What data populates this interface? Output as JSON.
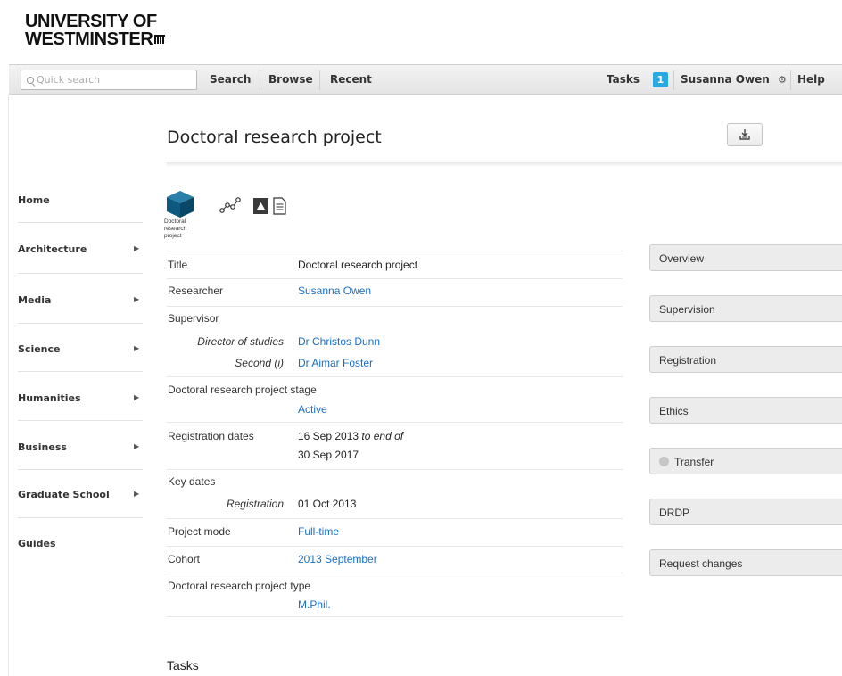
{
  "brand": {
    "line1": "UNIVERSITY OF",
    "line2": "WESTMINSTER"
  },
  "topbar": {
    "search_placeholder": "Quick search",
    "links": [
      "Search",
      "Browse",
      "Recent"
    ],
    "tasks_label": "Tasks",
    "tasks_count": "1",
    "user_name": "Susanna Owen",
    "help_label": "Help"
  },
  "page": {
    "title": "Doctoral research project"
  },
  "sidebar": {
    "items": [
      {
        "label": "Home",
        "has_arrow": false
      },
      {
        "label": "Architecture",
        "has_arrow": true
      },
      {
        "label": "Media",
        "has_arrow": true
      },
      {
        "label": "Science",
        "has_arrow": true
      },
      {
        "label": "Humanities",
        "has_arrow": true
      },
      {
        "label": "Business",
        "has_arrow": true
      },
      {
        "label": "Graduate School",
        "has_arrow": true
      },
      {
        "label": "Guides",
        "has_arrow": false
      }
    ],
    "arrow_glyph": "▶"
  },
  "object": {
    "icon_label_lines": [
      "Doctoral",
      "research",
      "project"
    ],
    "tool_icons": [
      "relationships-icon",
      "up-triangle-icon",
      "document-icon"
    ]
  },
  "details": {
    "title_label": "Title",
    "title_value": "Doctoral research project",
    "researcher_label": "Researcher",
    "researcher_value": "Susanna Owen",
    "supervisor_label": "Supervisor",
    "director_label": "Director of studies",
    "director_value": "Dr Christos Dunn",
    "second_label": "Second (i)",
    "second_value": "Dr Aimar Foster",
    "stage_label": "Doctoral research project stage",
    "stage_value": "Active",
    "registration_dates_label": "Registration dates",
    "registration_start": "16 Sep 2013",
    "registration_mid": "to end of",
    "registration_end": "30 Sep 2017",
    "key_dates_label": "Key dates",
    "registration_label": "Registration",
    "registration_value": "01 Oct 2013",
    "mode_label": "Project mode",
    "mode_value": "Full-time",
    "cohort_label": "Cohort",
    "cohort_value": "2013 September",
    "type_label": "Doctoral research project type",
    "type_value": "M.Phil."
  },
  "actions": {
    "overview": "Overview",
    "supervision": "Supervision",
    "registration": "Registration",
    "ethics": "Ethics",
    "transfer": "Transfer",
    "drdp": "DRDP",
    "request_changes": "Request changes"
  },
  "tasks_section": {
    "heading": "Tasks"
  },
  "colors": {
    "link": "#1a6fc4",
    "badge": "#2aa9e0",
    "cube": "#0d5a80"
  }
}
